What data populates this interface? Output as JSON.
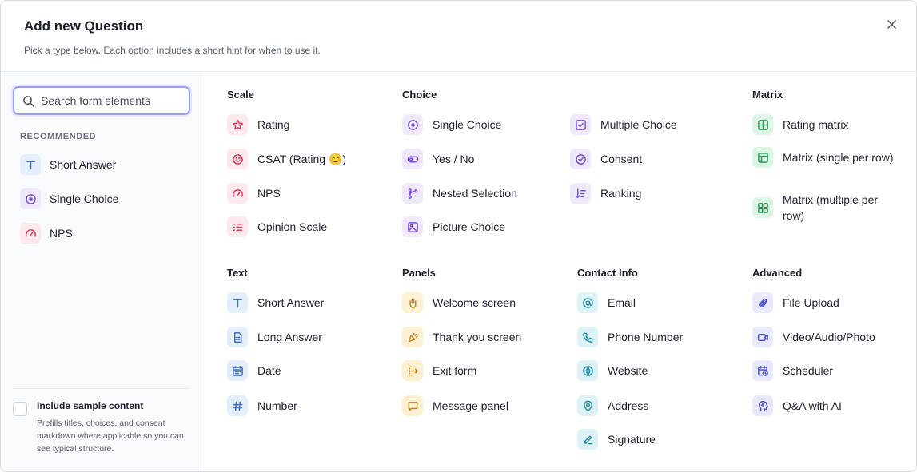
{
  "header": {
    "title": "Add new Question",
    "subtitle": "Pick a type below. Each option includes a short hint for when to use it."
  },
  "search": {
    "placeholder": "Search form elements"
  },
  "recommended": {
    "label": "RECOMMENDED",
    "items": [
      {
        "label": "Short Answer",
        "icon": "text-t-icon"
      },
      {
        "label": "Single Choice",
        "icon": "radio-icon"
      },
      {
        "label": "NPS",
        "icon": "gauge-icon"
      }
    ]
  },
  "sample": {
    "label": "Include sample content",
    "description": "Prefills titles, choices, and consent markdown where applicable so you can see typical structure.",
    "checked": false
  },
  "sections": {
    "scale": {
      "title": "Scale",
      "items": [
        "Rating",
        "CSAT (Rating 😊)",
        "NPS",
        "Opinion Scale"
      ]
    },
    "choice": {
      "title": "Choice",
      "items": [
        "Single Choice",
        "Yes / No",
        "Nested Selection",
        "Picture Choice"
      ]
    },
    "choice2": {
      "items": [
        "Multiple Choice",
        "Consent",
        "Ranking"
      ]
    },
    "matrix": {
      "title": "Matrix",
      "items": [
        "Rating matrix",
        "Matrix (single per row)",
        "Matrix (multiple per row)"
      ]
    },
    "text": {
      "title": "Text",
      "items": [
        "Short Answer",
        "Long Answer",
        "Date",
        "Number"
      ]
    },
    "panels": {
      "title": "Panels",
      "items": [
        "Welcome screen",
        "Thank you screen",
        "Exit form",
        "Message panel"
      ]
    },
    "contact": {
      "title": "Contact Info",
      "items": [
        "Email",
        "Phone Number",
        "Website",
        "Address",
        "Signature"
      ]
    },
    "advanced": {
      "title": "Advanced",
      "items": [
        "File Upload",
        "Video/Audio/Photo",
        "Scheduler",
        "Q&A with AI"
      ]
    }
  },
  "colors": {
    "scale": "#d63a5e",
    "choice": "#7a4fd1",
    "matrix": "#2e9a5a",
    "text": "#3f6fc2",
    "panels": "#c7831b",
    "contact": "#2a8fa3",
    "advanced": "#4b4fc4"
  }
}
